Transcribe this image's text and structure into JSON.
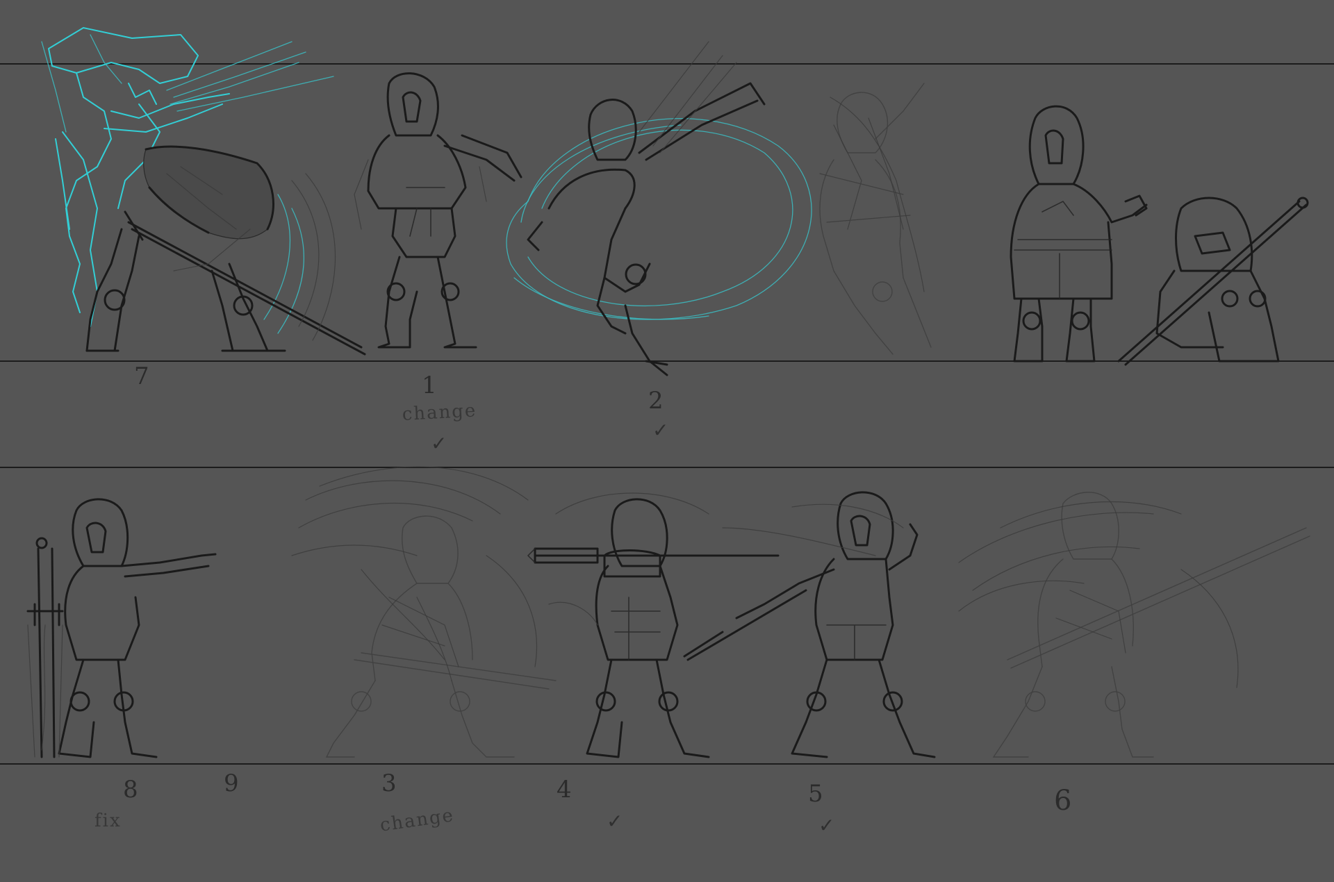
{
  "canvas": {
    "background": "#555555",
    "guide_color": "#1c1c1c",
    "ink_color": "#1a1a1a",
    "highlight_color": "#33cfd6"
  },
  "annotations": {
    "pose_7": "7",
    "pose_1": "1",
    "pose_1_note": "change",
    "pose_1_check": "✓",
    "pose_2": "2",
    "pose_2_check": "✓",
    "pose_8": "8",
    "pose_8_note": "fix",
    "pose_9": "9",
    "pose_3": "3",
    "pose_3_note": "change",
    "pose_4": "4",
    "pose_4_check": "✓",
    "pose_5": "5",
    "pose_5_check": "✓",
    "pose_6": "6"
  }
}
